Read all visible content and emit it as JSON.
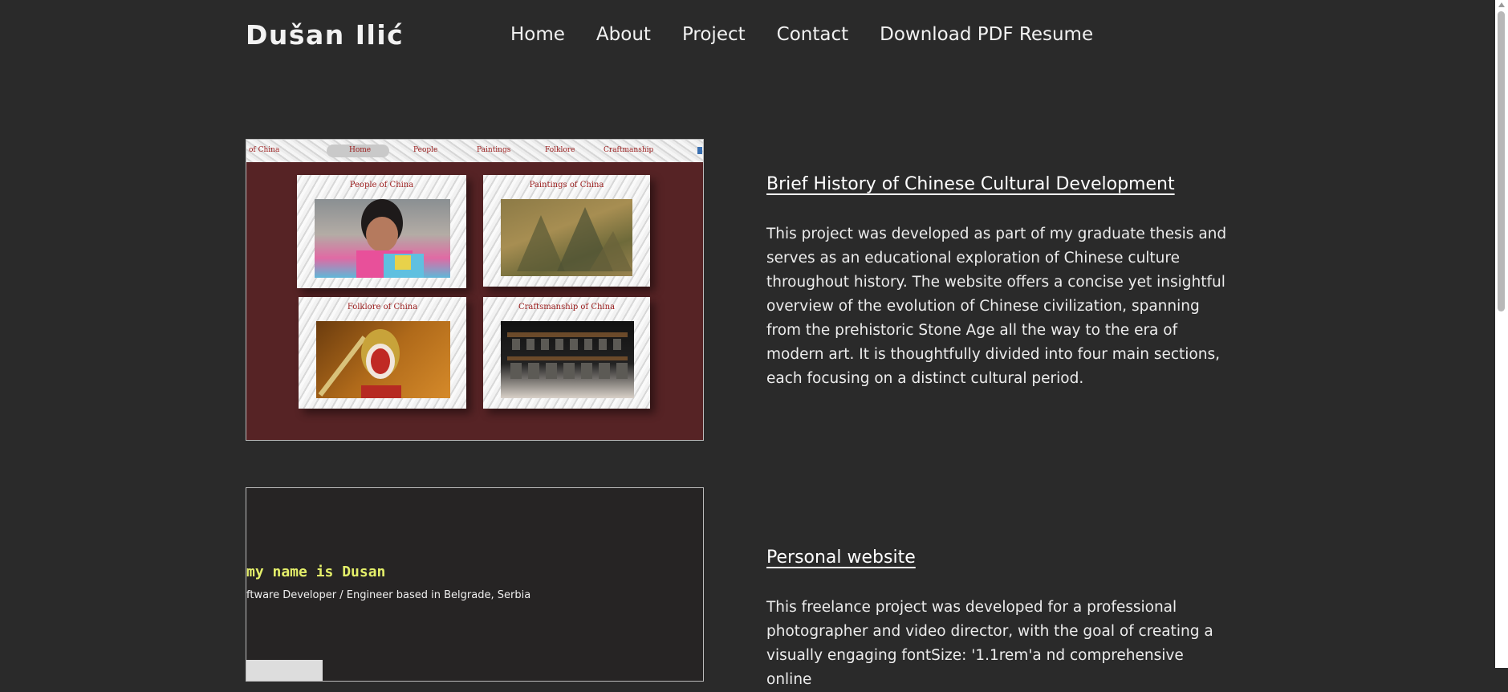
{
  "header": {
    "logo": "Dušan Ilić",
    "nav": [
      "Home",
      "About",
      "Project",
      "Contact",
      "Download PDF Resume"
    ]
  },
  "projects": [
    {
      "title": "Brief History of Chinese Cultural Development",
      "description": "This project was developed as part of my graduate thesis and serves as an educational exploration of Chinese culture throughout history. The website offers a concise yet insightful overview of the evolution of Chinese civilization, spanning from the prehistoric Stone Age all the way to the era of modern art. It is thoughtfully divided into four main sections, each focusing on a distinct cultural period.",
      "screenshot": {
        "nav": [
          "of China",
          "Home",
          "People",
          "Paintings",
          "Folklore",
          "Craftmanship"
        ],
        "cards": [
          "People of China",
          "Paintings of China",
          "Folklore of China",
          "Craftsmanship of China"
        ]
      }
    },
    {
      "title": "Personal website",
      "description": "This freelance project was developed for a professional photographer and video director, with the goal of creating a visually engaging fontSize: '1.1rem'a nd comprehensive online",
      "screenshot": {
        "greeting": "my name is Dusan",
        "role": "ftware Developer / Engineer based in Belgrade, Serbia"
      }
    }
  ]
}
